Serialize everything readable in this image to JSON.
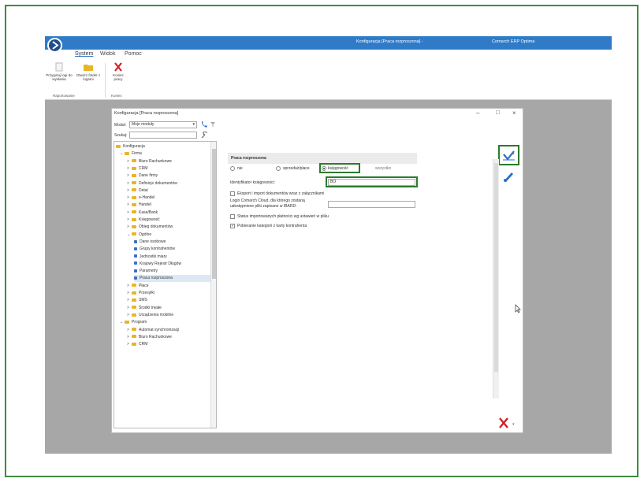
{
  "window": {
    "title": "Konfiguracja [Praca rozproszona] -",
    "app_name": "Comarch ERP Optima"
  },
  "ribbon": {
    "tabs": [
      "System",
      "Widok",
      "Pomoc"
    ],
    "buttons": {
      "logs": "Przygotuj logi do wysłania",
      "open_folder": "Otwórz folder z logami",
      "exit": "Koniec pracy"
    },
    "groups": {
      "reporting": "Raportowanie",
      "end": "Koniec"
    }
  },
  "dialog": {
    "title": "Konfiguracja [Praca rozproszona]",
    "module_label": "Moduł:",
    "module_value": "Moje moduły",
    "search_label": "Szukaj:",
    "search_value": ""
  },
  "tree": [
    {
      "label": "Konfiguracja",
      "level": 0,
      "type": "root"
    },
    {
      "label": "Firma",
      "level": 1,
      "type": "folder",
      "expanded": true
    },
    {
      "label": "Biuro Rachunkowe",
      "level": 2,
      "type": "folder"
    },
    {
      "label": "CRM",
      "level": 2,
      "type": "folder"
    },
    {
      "label": "Dane firmy",
      "level": 2,
      "type": "folder"
    },
    {
      "label": "Definicje dokumentów",
      "level": 2,
      "type": "folder"
    },
    {
      "label": "Detal",
      "level": 2,
      "type": "folder"
    },
    {
      "label": "e-Handel",
      "level": 2,
      "type": "folder"
    },
    {
      "label": "Handel",
      "level": 2,
      "type": "folder"
    },
    {
      "label": "Kasa/Bank",
      "level": 2,
      "type": "folder"
    },
    {
      "label": "Księgowość",
      "level": 2,
      "type": "folder"
    },
    {
      "label": "Obieg dokumentów",
      "level": 2,
      "type": "folder"
    },
    {
      "label": "Ogólne",
      "level": 2,
      "type": "folder",
      "expanded": true
    },
    {
      "label": "Dane osobowe",
      "level": 3,
      "type": "leaf"
    },
    {
      "label": "Grupy kontrahentów",
      "level": 3,
      "type": "leaf"
    },
    {
      "label": "Jednostki miary",
      "level": 3,
      "type": "leaf"
    },
    {
      "label": "Krajowy Rejestr Długów",
      "level": 3,
      "type": "leaf"
    },
    {
      "label": "Parametry",
      "level": 3,
      "type": "leaf"
    },
    {
      "label": "Praca rozproszona",
      "level": 3,
      "type": "leaf",
      "selected": true
    },
    {
      "label": "Płace",
      "level": 2,
      "type": "folder"
    },
    {
      "label": "Przesyłki",
      "level": 2,
      "type": "folder"
    },
    {
      "label": "SMS",
      "level": 2,
      "type": "folder"
    },
    {
      "label": "Środki trwałe",
      "level": 2,
      "type": "folder"
    },
    {
      "label": "Urządzenia mobilne",
      "level": 2,
      "type": "folder"
    },
    {
      "label": "Program",
      "level": 1,
      "type": "folder",
      "expanded": true
    },
    {
      "label": "Automat synchronizacji",
      "level": 2,
      "type": "folder"
    },
    {
      "label": "Biuro Rachunkowe",
      "level": 2,
      "type": "folder"
    },
    {
      "label": "CRM",
      "level": 2,
      "type": "folder"
    }
  ],
  "panel": {
    "header": "Praca rozproszona",
    "radios": {
      "nie": "nie",
      "sprzedaz": "sprzedaż/płace",
      "ksiegowosc": "księgowość",
      "wszystko": "wszystko"
    },
    "selected_radio": "ksiegowosc",
    "identifier_label": "Identyfikator księgowości:",
    "identifier_value": "BO",
    "checkboxes": {
      "export": "Eksport i import dokumentów wraz z załącznikami",
      "status": "Status importowanych płatności wg ustawień w pliku",
      "categories": "Pobieranie kategorii z karty kontrahenta"
    },
    "checked": {
      "export": false,
      "status": false,
      "categories": true
    },
    "cloud_label_1": "Login Comarch Cloud, dla którego zostaną",
    "cloud_label_2": "udostępnione pliki zapisane w IBARD:",
    "cloud_value": ""
  },
  "colors": {
    "titlebar": "#2f7bc8",
    "highlight": "#2d7a2d",
    "folder": "#e8b526",
    "leaf": "#3a6fc4"
  }
}
